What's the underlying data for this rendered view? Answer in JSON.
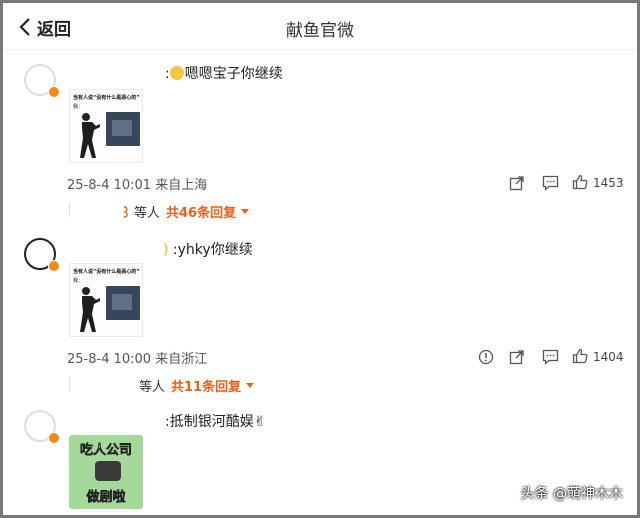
{
  "header": {
    "back_label": "返回",
    "title": "献鱼官微"
  },
  "comments": [
    {
      "text": "嗯嗯宝子你继续",
      "meme_caption": "当有人说“没有什么是恶心的”",
      "meme_caption2": "我：",
      "time_location": "25-8-4 10:01 来自上海",
      "likes": "1453",
      "replies_prefix": "等人",
      "replies_more": "共46条回复"
    },
    {
      "text": "yhky你继续",
      "meme_caption": "当有人说“没有什么是恶心的”",
      "meme_caption2": "我：",
      "time_location": "25-8-4 10:00 来自浙江",
      "likes": "1404",
      "replies_prefix": "等人",
      "replies_more": "共11条回复"
    },
    {
      "text": "抵制银河酷娱✌",
      "meme_top": "吃人公司",
      "meme_bottom": "做剧啦"
    }
  ],
  "watermark": "头条 @萌神木木",
  "colors": {
    "accent": "#e8621d",
    "verified": "#f08a1d"
  }
}
